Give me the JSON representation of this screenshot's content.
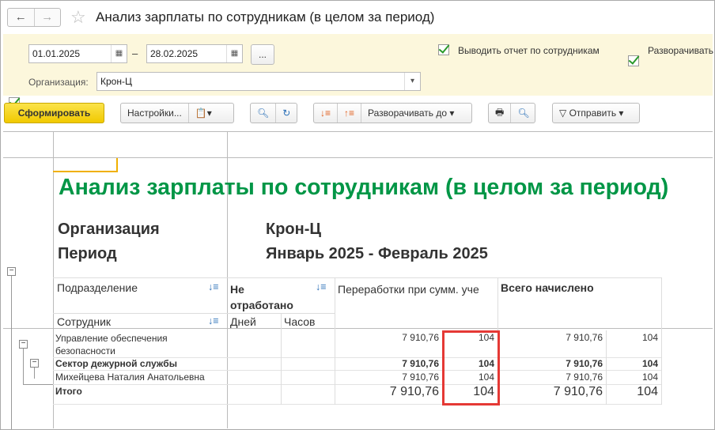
{
  "window": {
    "title": "Анализ зарплаты по сотрудникам (в целом за период)",
    "back": "←",
    "forward": "→",
    "star": "☆"
  },
  "filter": {
    "date_from": "01.01.2025",
    "dash": "–",
    "date_to": "28.02.2025",
    "more": "...",
    "show_by_employees": "Выводить отчет по сотрудникам",
    "expand": "Разворачивать",
    "org_label": "Организация:",
    "org_value": "Крон-Ц"
  },
  "toolbar": {
    "generate": "Сформировать",
    "settings": "Настройки...",
    "expand_to": "Разворачивать до",
    "send": "Отправить"
  },
  "report": {
    "title": "Анализ зарплаты по сотрудникам (в целом за период)",
    "org_label": "Организация",
    "org_value": "Крон-Ц",
    "period_label": "Период",
    "period_value": "Январь 2025 - Февраль 2025",
    "headers": {
      "division": "Подразделение",
      "employee": "Сотрудник",
      "not_worked": "Не отработано",
      "days": "Дней",
      "hours": "Часов",
      "overtime": "Переработки при сумм. уче",
      "total": "Всего начислено"
    },
    "rows": [
      {
        "name": "Управление обеспечения безопасности",
        "ot_sum": "7 910,76",
        "ot_hours": "104",
        "tot_sum": "7 910,76",
        "tot_hours": "104"
      },
      {
        "name": "Сектор дежурной службы",
        "ot_sum": "7 910,76",
        "ot_hours": "104",
        "tot_sum": "7 910,76",
        "tot_hours": "104"
      },
      {
        "name": "Михейцева Наталия Анатольевна",
        "ot_sum": "7 910,76",
        "ot_hours": "104",
        "tot_sum": "7 910,76",
        "tot_hours": "104"
      },
      {
        "name": "Итого",
        "ot_sum": "7 910,76",
        "ot_hours": "104",
        "tot_sum": "7 910,76",
        "tot_hours": "104"
      }
    ]
  },
  "colors": {
    "title_green": "#009646",
    "highlight": "#e53935",
    "filter_bg": "#fcf7dc"
  }
}
